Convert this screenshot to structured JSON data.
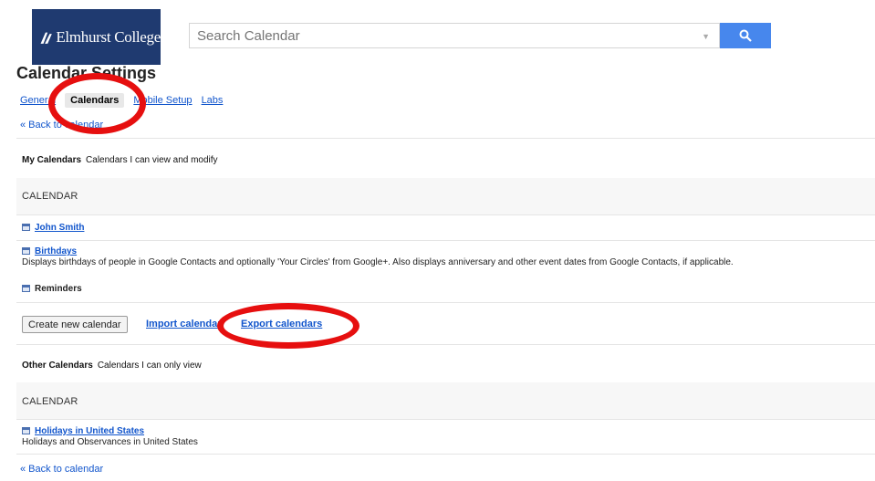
{
  "header": {
    "logo_text": "Elmhurst College",
    "search_placeholder": "Search Calendar"
  },
  "page": {
    "title": "Calendar Settings",
    "tabs": [
      {
        "label": "General",
        "active": false
      },
      {
        "label": "Calendars",
        "active": true
      },
      {
        "label": "Mobile Setup",
        "active": false
      },
      {
        "label": "Labs",
        "active": false
      }
    ],
    "back_link": "« Back to calendar"
  },
  "my_calendars": {
    "title": "My Calendars",
    "subtitle": "Calendars I can view and modify",
    "column_header": "CALENDAR",
    "items": [
      {
        "name": "John Smith",
        "description": ""
      },
      {
        "name": "Birthdays",
        "description": "Displays birthdays of people in Google Contacts and optionally 'Your Circles' from Google+. Also displays anniversary and other event dates from Google Contacts, if applicable."
      },
      {
        "name": "Reminders",
        "description": ""
      }
    ],
    "create_button": "Create new calendar",
    "import_link": "Import calendar",
    "export_link": "Export calendars"
  },
  "other_calendars": {
    "title": "Other Calendars",
    "subtitle": "Calendars I can only view",
    "column_header": "CALENDAR",
    "items": [
      {
        "name": "Holidays in United States",
        "description": "Holidays and Observances in United States"
      }
    ]
  },
  "colors": {
    "logo_bg": "#1f3a70",
    "search_button": "#4787ed",
    "link": "#1155cc",
    "annotation": "#e60f0f"
  },
  "icons": {
    "search_button": "search-icon",
    "calendar_row": "calendar-icon"
  }
}
